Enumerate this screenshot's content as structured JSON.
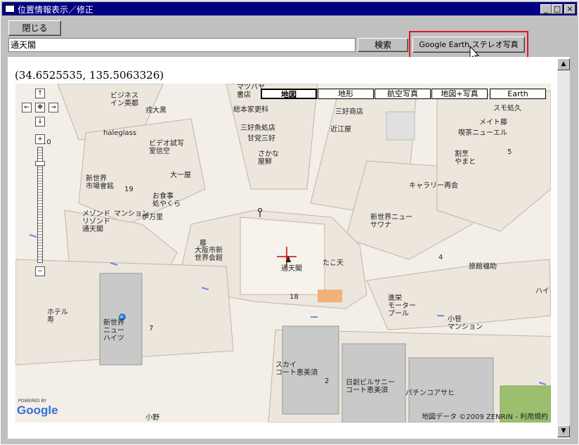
{
  "window": {
    "title": "位置情報表示／修正"
  },
  "titlebar_buttons": [
    "_",
    "□",
    "×"
  ],
  "toolbar": {
    "close_label": "閉じる",
    "search_value": "通天閣",
    "search_label": "検索",
    "stereo_label": "Google Earth ステレオ写真"
  },
  "coords": "(34.6525535, 135.5063326)",
  "map": {
    "types": [
      "地図",
      "地形",
      "航空写真",
      "地図+写真",
      "Earth"
    ],
    "active_type": "地図",
    "zoom_level": 0.88,
    "labels": {
      "l1": "ビジネス\nイン英都",
      "l2": "戎大黒",
      "l3": "haleglass",
      "l4": "ビデオ試写\n室信空",
      "l5": "大一屋",
      "l6": "新世界\n市場會銘",
      "l7": "お食事\n処やくら",
      "l8": "伊万里",
      "l9": "メゾンド\nリゾンド\n通天閣",
      "l10": "マンション",
      "l11": "マツバヤ\n書店",
      "l12": "総本家更科",
      "l13": "三好魚処店",
      "l14": "甘党三好",
      "l15": "さかな\n屋鮮",
      "l16": "三好商店",
      "l17": "近江屋",
      "l18": "スモ処久",
      "l19": "メイト藤",
      "l20": "喫茶ニューエル",
      "l21": "割烹\nやまと",
      "l22": "キャラリー再会",
      "l23": "新世界ニュー\nサワナ",
      "l24": "旅館福助",
      "l25": "大阪市新\n世界会館",
      "l26": "通天閣",
      "l27": "たこ天",
      "l28": "進栄\nモーター\nプール",
      "l29": "小笹\nマンション",
      "l30": "ホテル\n寿",
      "l31": "新世界\nニュー\nハイツ",
      "l32": "スカイ\nコート恵美須",
      "l33": "日創ビルサニー\nコート恵美須",
      "l34": "パチンコアサヒ",
      "l35": "小野",
      "l36": "藤",
      "l37": "ハイ",
      "n1": "10",
      "n2": "19",
      "n3": "18",
      "n4": "4",
      "n5": "5",
      "n6": "7",
      "n7": "2"
    },
    "powered_by": "POWERED BY",
    "google": "Google",
    "copyright": "地図データ ©2009 ZENRIN - 利用規約"
  },
  "colors": {
    "titlebar": "#000080",
    "highlight": "#e8131f",
    "map_bg": "#f3efe8",
    "block": "#ece6dc",
    "road": "#ffffff",
    "building": "#c9c9c9"
  }
}
